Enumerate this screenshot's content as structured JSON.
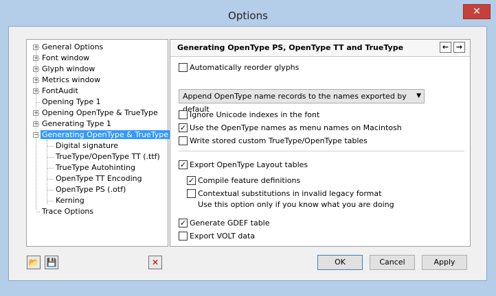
{
  "window": {
    "title": "Options",
    "close_glyph": "✕"
  },
  "tree": {
    "items": [
      {
        "label": "General Options",
        "expander": "+"
      },
      {
        "label": "Font window",
        "expander": "+"
      },
      {
        "label": "Glyph window",
        "expander": "+"
      },
      {
        "label": "Metrics window",
        "expander": "+"
      },
      {
        "label": "FontAudit",
        "expander": "+"
      },
      {
        "label": "Opening Type 1",
        "expander": ""
      },
      {
        "label": "Opening OpenType & TrueType",
        "expander": "+"
      },
      {
        "label": "Generating Type 1",
        "expander": "+"
      },
      {
        "label": "Generating OpenType & TrueType",
        "expander": "−"
      },
      {
        "label": "Digital signature",
        "expander": ""
      },
      {
        "label": "TrueType/OpenType TT (.ttf)",
        "expander": ""
      },
      {
        "label": "TrueType Autohinting",
        "expander": ""
      },
      {
        "label": "OpenType TT Encoding",
        "expander": ""
      },
      {
        "label": "OpenType PS (.otf)",
        "expander": ""
      },
      {
        "label": "Kerning",
        "expander": ""
      },
      {
        "label": "Trace Options",
        "expander": ""
      }
    ]
  },
  "panel": {
    "title": "Generating OpenType PS, OpenType TT and TrueType",
    "nav_back": "←",
    "nav_forward": "→",
    "reorder_glyphs": {
      "label": "Automatically reorder glyphs",
      "checked": false
    },
    "name_records_select": "Append OpenType name records to the names exported by default",
    "select_arrow": "▼",
    "ignore_unicode": {
      "label": "Ignore Unicode indexes in the font",
      "checked": false
    },
    "menu_names_mac": {
      "label": "Use the OpenType names as menu names on Macintosh",
      "checked": true
    },
    "custom_tables": {
      "label": "Write stored custom TrueType/OpenType tables",
      "checked": false
    },
    "export_layout": {
      "label": "Export OpenType Layout tables",
      "checked": true
    },
    "compile_features": {
      "label": "Compile feature definitions",
      "checked": true
    },
    "contextual_subs": {
      "label": "Contextual substitutions in invalid legacy format",
      "checked": false
    },
    "contextual_note": "Use this option only if you know what you are doing",
    "gdef": {
      "label": "Generate GDEF table",
      "checked": true
    },
    "volt": {
      "label": "Export VOLT data",
      "checked": false
    },
    "check_glyph": "✓"
  },
  "footer": {
    "open_icon": "📂",
    "save_icon": "💾",
    "delete_glyph": "✕",
    "delete_color": "#c00000",
    "ok_label": "OK",
    "cancel_label": "Cancel",
    "apply_label": "Apply"
  }
}
